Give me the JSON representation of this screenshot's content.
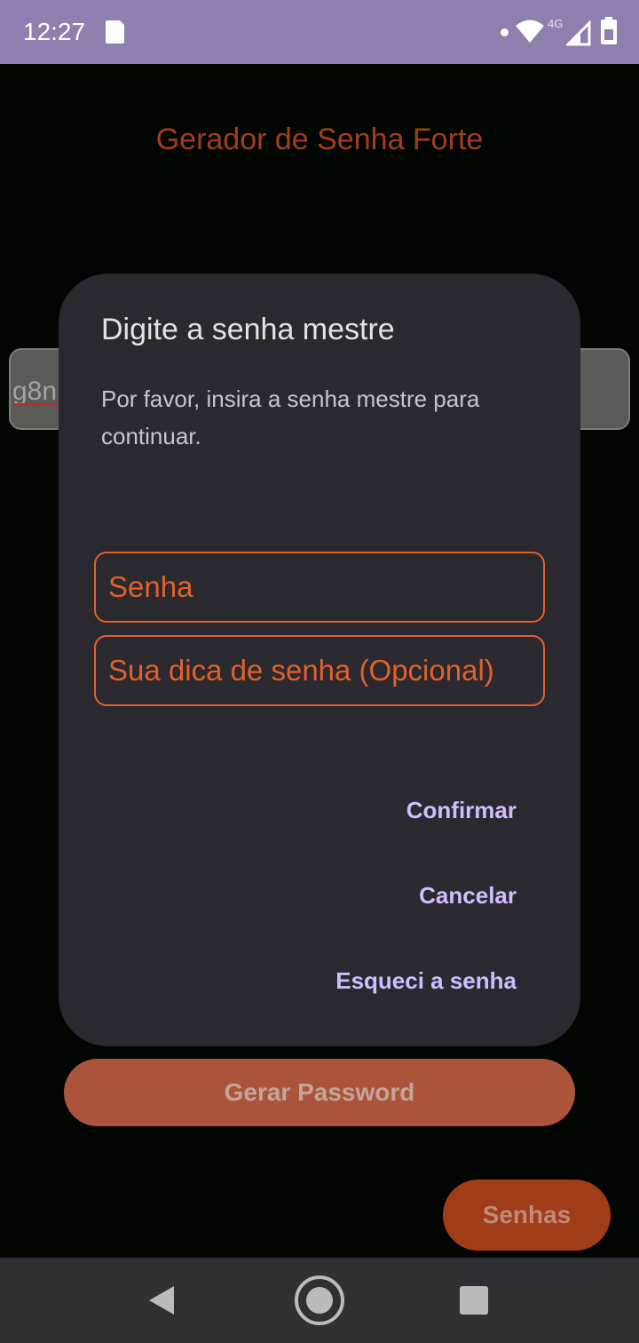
{
  "status_bar": {
    "time": "12:27",
    "network_label": "4G",
    "icons": [
      "sim-card-icon",
      "notification-dot-icon",
      "wifi-icon",
      "cell-signal-icon",
      "battery-icon"
    ]
  },
  "app": {
    "title": "Gerador de Senha Forte",
    "password_value": "g8n",
    "generate_button_label": "Gerar Password",
    "senhas_button_label": "Senhas"
  },
  "dialog": {
    "title": "Digite a senha mestre",
    "message": "Por favor, insira a senha mestre para continuar.",
    "password_placeholder": "Senha",
    "hint_placeholder": "Sua dica de senha (Opcional)",
    "confirm_label": "Confirmar",
    "cancel_label": "Cancelar",
    "forgot_label": "Esqueci a senha"
  },
  "nav_bar": {
    "icons": [
      "back-icon",
      "home-icon",
      "recents-icon"
    ]
  },
  "colors": {
    "status_bar": "#8e7fae",
    "background": "#020602",
    "dialog": "#2b2930",
    "accent_orange": "#e2612a",
    "action_text": "#d0bcff",
    "button": "#ab543b"
  }
}
